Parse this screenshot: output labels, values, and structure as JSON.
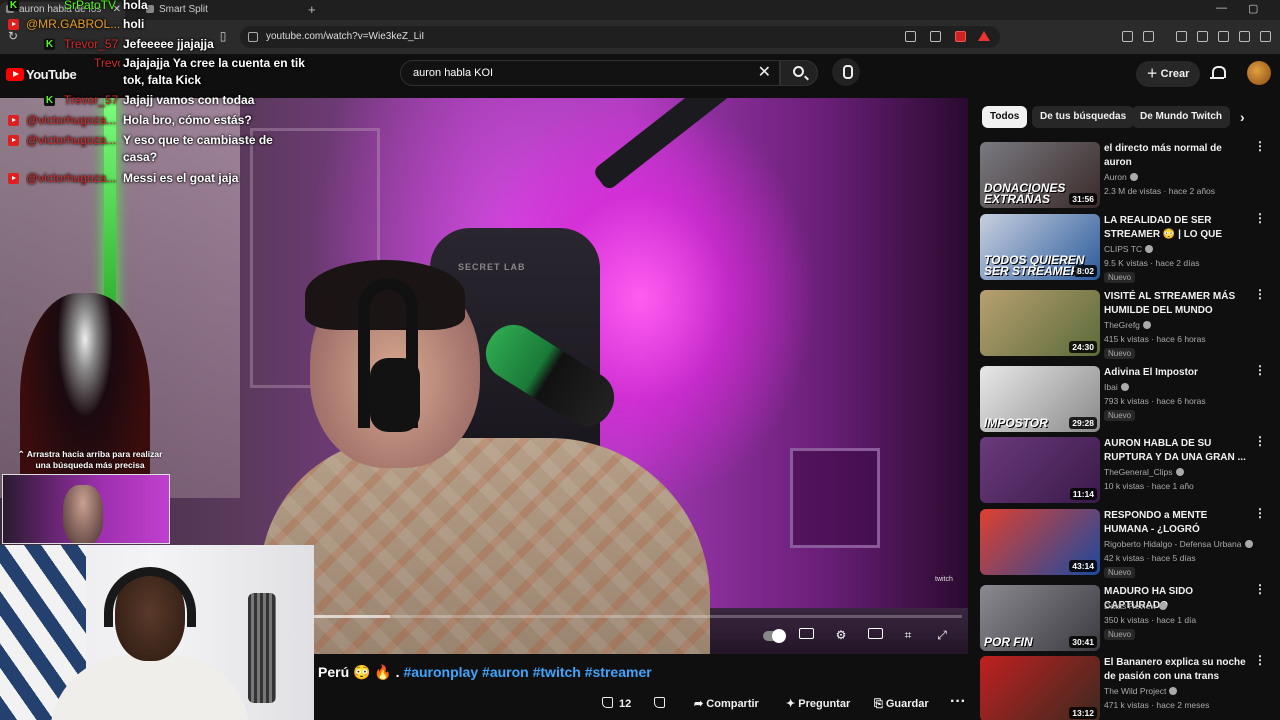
{
  "browser": {
    "tabs": [
      {
        "label": "auron habla de los streamer",
        "active": true
      },
      {
        "label": "Smart Split",
        "active": false
      }
    ],
    "url": "youtube.com/watch?v=Wie3keZ_LiI"
  },
  "youtube": {
    "logo_text": "YouTube",
    "search_value": "auron habla KOI",
    "create_label": "Crear"
  },
  "chat": [
    {
      "platform": "kick",
      "user": "SrPatoTV",
      "message": "hola"
    },
    {
      "platform": "youtube",
      "user": "@MR.GABROL...",
      "message": "holi"
    },
    {
      "platform": "kick",
      "user": "Trevor_57",
      "message": "Jefeeeee jjajajja"
    },
    {
      "platform": "kick",
      "user": "Trevor_57",
      "message": "Jajajajja Ya cree la cuenta en tik tok, falta Kick"
    },
    {
      "platform": "kick",
      "user": "Trevor_57",
      "message": "Jajajj vamos con todaa"
    },
    {
      "platform": "youtube",
      "user": "@victorhugoza...",
      "message": "Hola bro, cómo estás?"
    },
    {
      "platform": "youtube",
      "user": "@victorhugoza...",
      "message": "Y eso que te cambiaste de casa?"
    },
    {
      "platform": "youtube",
      "user": "@victorhugoza...",
      "message": "Messi es el goat jaja"
    }
  ],
  "overlay": {
    "swipe_hint": "Arrastra hacia arriba para realizar una búsqueda más precisa",
    "stream_chair_text": "SECRET LAB",
    "watermark": "twitch"
  },
  "video": {
    "buffered_fraction": 0.12,
    "hashtags_prefix": "Perú 😳 🔥 .",
    "hashtags": [
      "#auronplay",
      "#auron",
      "#twitch",
      "#streamer"
    ]
  },
  "actions": {
    "like_count": "12",
    "share_label": "Compartir",
    "ask_label": "Preguntar",
    "save_label": "Guardar"
  },
  "chips": [
    "Todos",
    "De tus búsquedas",
    "De Mundo Twitch"
  ],
  "recommendations": [
    {
      "title": "el directo más normal de auron",
      "channel": "Auron",
      "meta": "2.3 M de vistas · hace 2 años",
      "duration": "31:56",
      "overlay": "DONACIONES EXTRAÑAS",
      "new": false,
      "colors": [
        "#7a7a80",
        "#3a2a2a"
      ]
    },
    {
      "title": "LA REALIDAD DE SER STREAMER 😳 | LO QUE NADI...",
      "channel": "CLIPS TC",
      "meta": "9.5 K vistas · hace 2 días",
      "duration": "8:02",
      "overlay": "TODOS QUIEREN SER STREAMER",
      "new": true,
      "new_label": "Nuevo",
      "colors": [
        "#c8d0e0",
        "#2a5a9a"
      ]
    },
    {
      "title": "VISITÉ AL STREAMER MÁS HUMILDE DEL MUNDO",
      "channel": "TheGrefg",
      "meta": "415 k vistas · hace 6 horas",
      "duration": "24:30",
      "overlay": "",
      "new": true,
      "new_label": "Nuevo",
      "colors": [
        "#b8a070",
        "#5a6a3a"
      ]
    },
    {
      "title": "Adivina El Impostor",
      "channel": "Ibai",
      "meta": "793 k vistas · hace 6 horas",
      "duration": "29:28",
      "overlay": "IMPOSTOR",
      "new": true,
      "new_label": "Nuevo",
      "colors": [
        "#e8e8e8",
        "#8a8a8a"
      ]
    },
    {
      "title": "AURON HABLA DE SU RUPTURA Y DA UNA GRAN ...",
      "channel": "TheGeneral_Clips",
      "meta": "10 k vistas · hace 1 año",
      "duration": "11:14",
      "overlay": "",
      "new": false,
      "colors": [
        "#6a3a7a",
        "#3a1a4a"
      ]
    },
    {
      "title": "RESPONDO a MENTE HUMANA - ¿LOGRÓ DESMONTAR A DIOS?",
      "channel": "Rigoberto Hidalgo - Defensa Urbana",
      "meta": "42 k vistas · hace 5 días",
      "duration": "43:14",
      "overlay": "",
      "new": true,
      "new_label": "Nuevo",
      "colors": [
        "#e04030",
        "#1a4aa0"
      ]
    },
    {
      "title": "MADURO HA SIDO CAPTURADO",
      "channel": "Datas Review",
      "meta": "350 k vistas · hace 1 día",
      "duration": "30:41",
      "overlay": "POR FIN",
      "new": true,
      "new_label": "Nuevo",
      "colors": [
        "#8a8a90",
        "#3a3a40"
      ]
    },
    {
      "title": "El Bananero explica su noche de pasión con una trans",
      "channel": "The Wild Project",
      "meta": "471 k vistas · hace 2 meses",
      "duration": "13:12",
      "overlay": "",
      "new": false,
      "colors": [
        "#c02020",
        "#3a2a20"
      ]
    }
  ]
}
